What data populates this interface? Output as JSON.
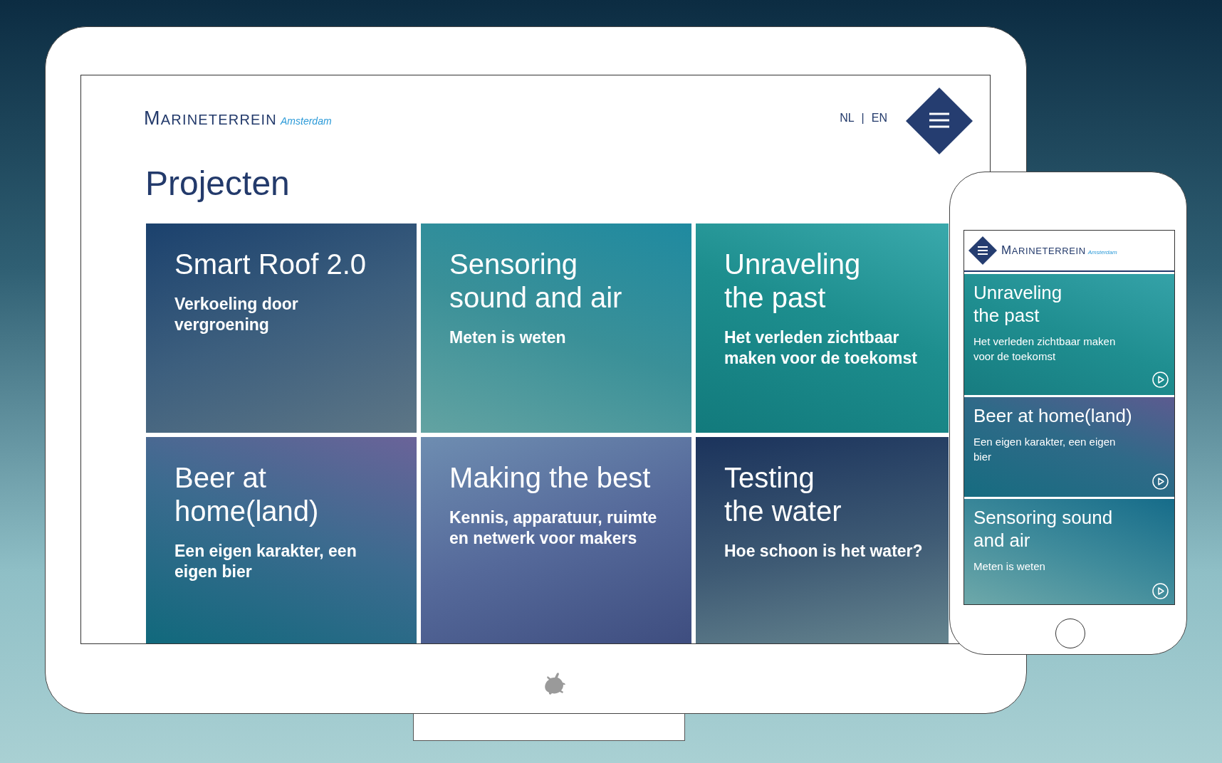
{
  "tablet": {
    "logo": {
      "name": "MARINETERREIN",
      "place": "Amsterdam"
    },
    "languages": [
      {
        "code": "NL"
      },
      {
        "code": "EN"
      }
    ],
    "language_separator": "|",
    "heading": "Projecten",
    "projects": [
      {
        "title": "Smart Roof 2.0",
        "subtitle": "Verkoeling door\nvergroening"
      },
      {
        "title": "Sensoring\nsound and air",
        "subtitle": "Meten is weten"
      },
      {
        "title": "Unraveling\nthe past",
        "subtitle": "Het verleden zichtbaar\nmaken voor de toekomst"
      },
      {
        "title": "Beer at\nhome(land)",
        "subtitle": "Een eigen karakter, een\neigen bier"
      },
      {
        "title": "Making the best",
        "subtitle": "Kennis, apparatuur, ruimte\nen netwerk voor makers"
      },
      {
        "title": "Testing\nthe water",
        "subtitle": "Hoe schoon is het water?"
      }
    ]
  },
  "phone": {
    "logo": {
      "name": "MARINETERREIN",
      "place": "Amsterdam"
    },
    "projects": [
      {
        "title": "Unraveling\nthe past",
        "subtitle": "Het verleden zichtbaar maken\nvoor de toekomst"
      },
      {
        "title": "Beer at home(land)",
        "subtitle": "Een eigen karakter, een eigen\nbier"
      },
      {
        "title": "Sensoring sound\nand air",
        "subtitle": "Meten is weten"
      }
    ]
  }
}
